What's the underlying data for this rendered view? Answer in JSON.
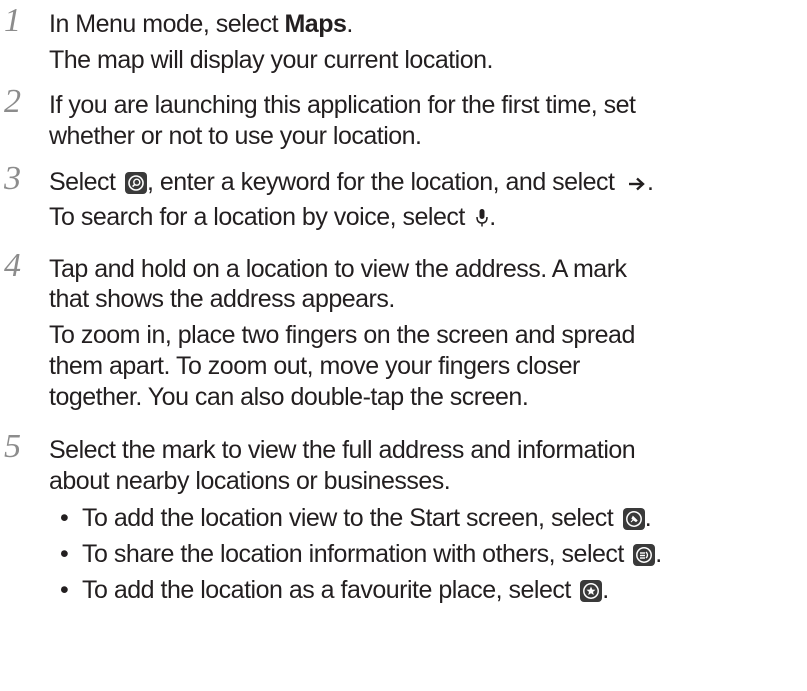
{
  "steps": [
    {
      "number": "1",
      "pre": "In Menu mode, select ",
      "bold": "Maps",
      "post": ".",
      "sub": "The map will display your current location."
    },
    {
      "number": "2",
      "line1": "If you are launching this application for the first time, set",
      "line2": "whether or not to use your location."
    },
    {
      "number": "3",
      "pre": "Select ",
      "mid": ", enter a keyword for the location, and select ",
      "post": ".",
      "sub_pre": "To search for a location by voice, select ",
      "sub_post": "."
    },
    {
      "number": "4",
      "line1": "Tap and hold on a location to view the address. A mark",
      "line2": "that shows the address appears.",
      "line3": "To zoom in, place two fingers on the screen and spread",
      "line4": "them apart. To zoom out, move your fingers closer",
      "line5": "together. You can also double-tap the screen."
    },
    {
      "number": "5",
      "line1": "Select the mark to view the full address and information",
      "line2": "about nearby locations or businesses.",
      "bullets": [
        {
          "text": "To add the location view to the Start screen, select ",
          "post": "."
        },
        {
          "text": "To share the location information with others, select ",
          "post": "."
        },
        {
          "text": "To add the location as a favourite place, select ",
          "post": "."
        }
      ]
    }
  ],
  "bullet_char": "•",
  "icons": [
    "search-icon",
    "arrow-right-icon",
    "microphone-icon",
    "pin-icon",
    "share-icon",
    "favourite-icon"
  ]
}
